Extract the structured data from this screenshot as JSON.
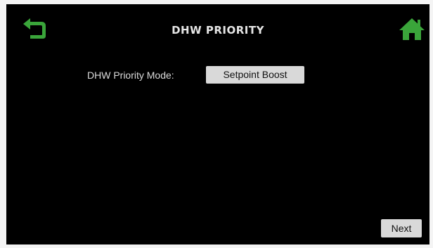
{
  "header": {
    "title": "DHW PRIORITY",
    "back_icon": "back-arrow-icon",
    "home_icon": "home-icon"
  },
  "main": {
    "mode_label": "DHW Priority Mode:",
    "mode_value": "Setpoint Boost"
  },
  "footer": {
    "next_label": "Next"
  },
  "colors": {
    "accent": "#3aa53a",
    "background": "#000000",
    "button": "#d9d9d9"
  }
}
